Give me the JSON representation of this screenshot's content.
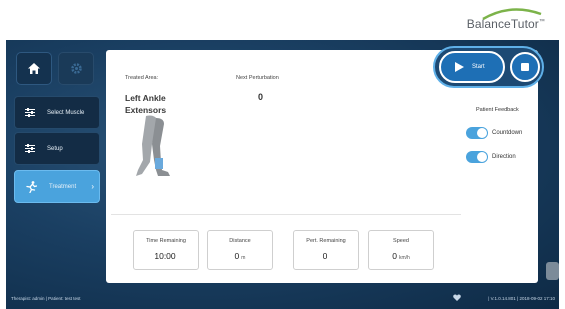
{
  "brand": {
    "name": "BalanceTutor",
    "mark": "™"
  },
  "sidebar": {
    "items": [
      {
        "label": "Select Muscle"
      },
      {
        "label": "Setup"
      },
      {
        "label": "Treatment"
      }
    ]
  },
  "panel": {
    "treated_area_label": "Treated Area:",
    "treated_area_value_line1": "Left Ankle",
    "treated_area_value_line2": "Extensors",
    "next_perturbation_label": "Next Perturbation",
    "next_perturbation_value": "0"
  },
  "patient_feedback": {
    "title": "Patient Feedback",
    "toggles": [
      {
        "label": "Countdown",
        "on": true
      },
      {
        "label": "Direction",
        "on": true
      }
    ]
  },
  "stats": [
    {
      "label": "Time Remaining",
      "value": "10:00",
      "unit": ""
    },
    {
      "label": "Distance",
      "value": "0",
      "unit": "m"
    },
    {
      "label": "Pert. Remaining",
      "value": "0",
      "unit": ""
    },
    {
      "label": "Speed",
      "value": "0",
      "unit": "km/h"
    }
  ],
  "controls": {
    "start_label": "Start"
  },
  "footer": {
    "left": "Therapist: admin  |  Patient: test test",
    "right": "|  V.1.0.14.801  |  2018-09-02 17:10"
  },
  "colors": {
    "accent": "#4aa3dd",
    "background": "#1a3f62",
    "start": "#1e6fb5"
  }
}
